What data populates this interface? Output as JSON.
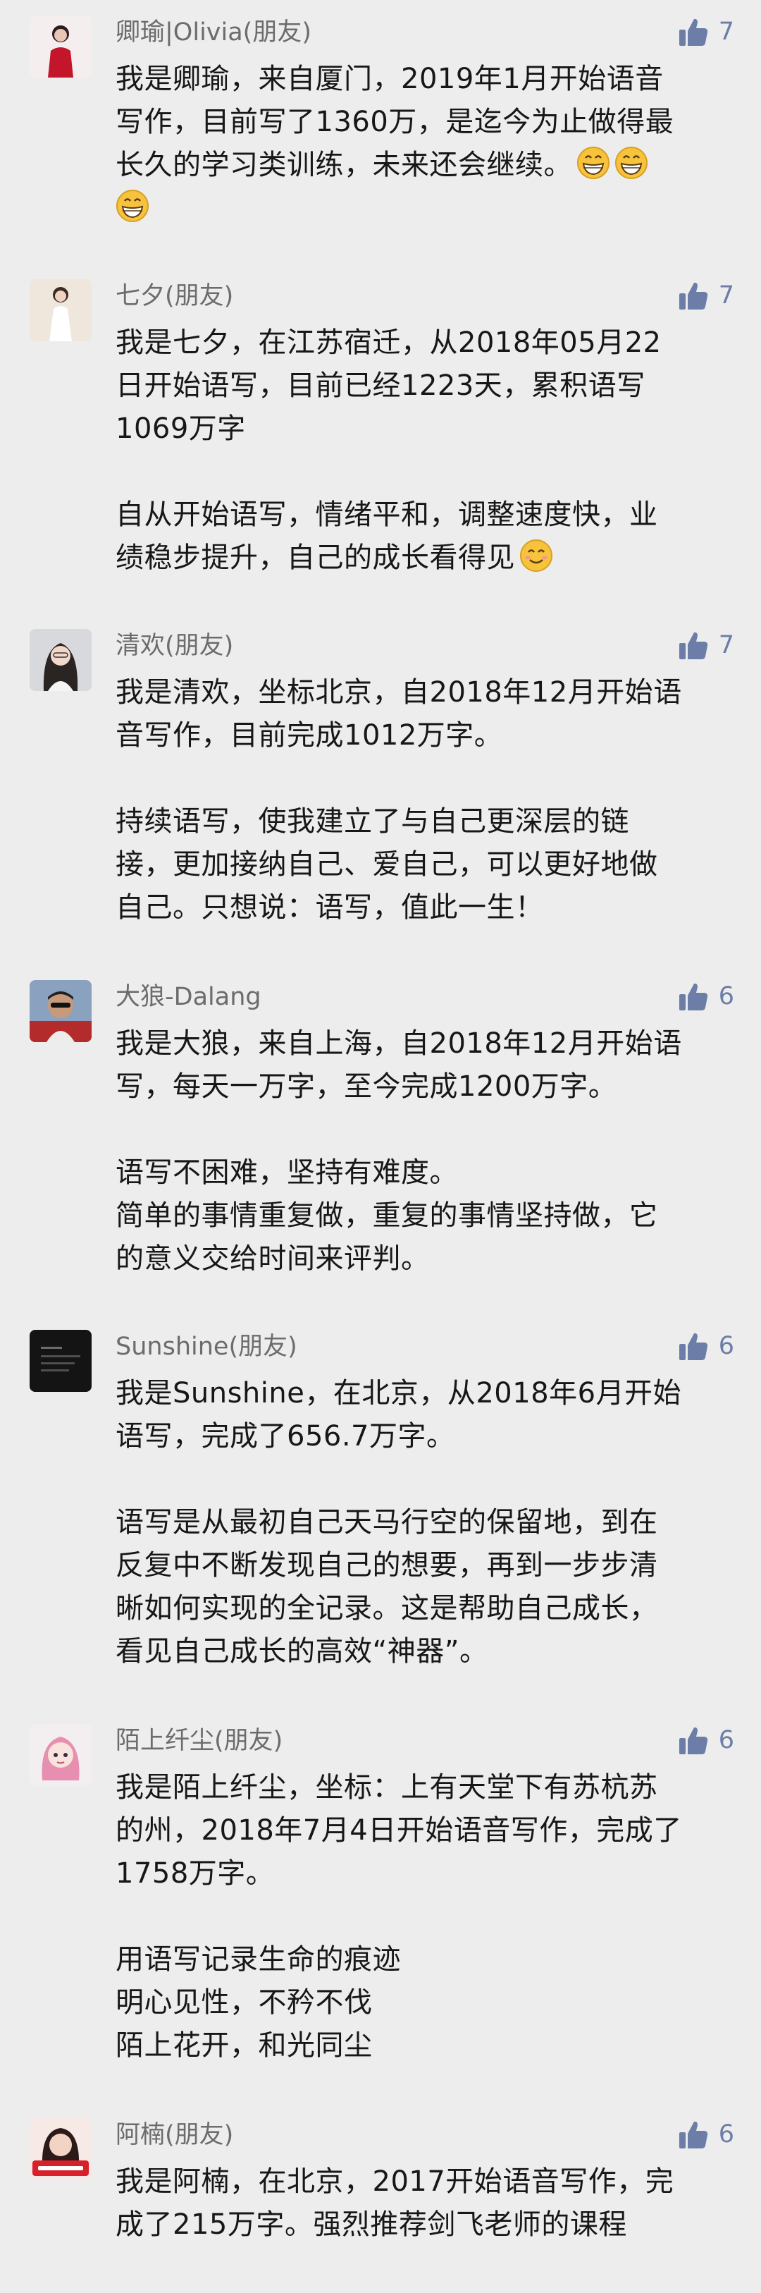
{
  "colors": {
    "background": "#ededed",
    "name_text": "#6c6c6c",
    "like_accent": "#6c7ea8",
    "body_text": "#171717"
  },
  "like_icon": "thumbs-up-icon",
  "comments": [
    {
      "name": "卿瑜|Olivia(朋友)",
      "likes": "7",
      "avatar": "portrait-red-dress",
      "paragraphs": [
        "我是卿瑜，来自厦门，2019年1月开始语音\n写作，目前写了1360万，是迄今为止做得最\n长久的学习类训练，未来还会继续。"
      ],
      "emoji_count": 3
    },
    {
      "name": "七夕(朋友)",
      "likes": "7",
      "avatar": "portrait-white-dress",
      "paragraphs": [
        "我是七夕，在江苏宿迁，从2018年05月22\n日开始语写，目前已经1223天，累积语写\n1069万字",
        "自从开始语写，情绪平和，调整速度快，业\n绩稳步提升，自己的成长看得见"
      ],
      "emoji": "smiling-face-icon"
    },
    {
      "name": "清欢(朋友)",
      "likes": "7",
      "avatar": "portrait-woman-long-hair",
      "paragraphs": [
        "我是清欢，坐标北京，自2018年12月开始语\n音写作，目前完成1012万字。",
        "持续语写，使我建立了与自己更深层的链\n接，更加接纳自己、爱自己，可以更好地做\n自己。只想说：语写，值此一生！"
      ]
    },
    {
      "name": "大狼-Dalang",
      "likes": "6",
      "avatar": "portrait-man-sunglasses",
      "paragraphs": [
        "我是大狼，来自上海，自2018年12月开始语\n写，每天一万字，至今完成1200万字。",
        "语写不困难，坚持有难度。\n简单的事情重复做，重复的事情坚持做，它\n的意义交给时间来评判。"
      ]
    },
    {
      "name": "Sunshine(朋友)",
      "likes": "6",
      "avatar": "dark-text-card",
      "paragraphs": [
        "我是Sunshine，在北京，从2018年6月开始\n语写，完成了656.7万字。",
        "语写是从最初自己天马行空的保留地，到在\n反复中不断发现自己的想要，再到一步步清\n晰如何实现的全记录。这是帮助自己成长，\n看见自己成长的高效“神器”。"
      ]
    },
    {
      "name": "陌上纤尘(朋友)",
      "likes": "6",
      "avatar": "illustrated-girl-pink-hair",
      "paragraphs": [
        "我是陌上纤尘，坐标：上有天堂下有苏杭苏\n的州，2018年7月4日开始语音写作，完成了\n1758万字。",
        "用语写记录生命的痕迹\n明心见性，不矜不伐\n陌上花开，和光同尘"
      ]
    },
    {
      "name": "阿楠(朋友)",
      "likes": "6",
      "avatar": "portrait-china-banner",
      "paragraphs": [
        "我是阿楠，在北京，2017开始语音写作，完\n成了215万字。强烈推荐剑飞老师的课程"
      ]
    }
  ]
}
